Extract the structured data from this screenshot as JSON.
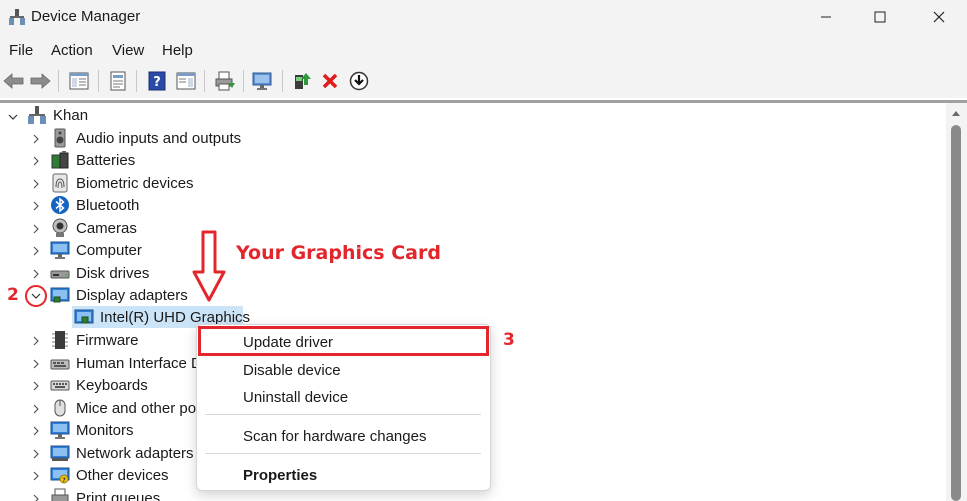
{
  "window": {
    "title": "Device Manager"
  },
  "menu": [
    "File",
    "Action",
    "View",
    "Help"
  ],
  "tree": {
    "root": "Khan",
    "items": [
      {
        "label": "Audio inputs and outputs",
        "icon": "speaker-icon"
      },
      {
        "label": "Batteries",
        "icon": "battery-icon"
      },
      {
        "label": "Biometric devices",
        "icon": "fingerprint-icon"
      },
      {
        "label": "Bluetooth",
        "icon": "bluetooth-icon"
      },
      {
        "label": "Cameras",
        "icon": "camera-icon"
      },
      {
        "label": "Computer",
        "icon": "monitor-icon"
      },
      {
        "label": "Disk drives",
        "icon": "disk-drive-icon"
      },
      {
        "label": "Display adapters",
        "icon": "display-adapter-icon",
        "expanded": true
      },
      {
        "label": "Firmware",
        "icon": "chip-icon"
      },
      {
        "label": "Human Interface D",
        "icon": "hid-icon"
      },
      {
        "label": "Keyboards",
        "icon": "keyboard-icon"
      },
      {
        "label": "Mice and other po",
        "icon": "mouse-icon"
      },
      {
        "label": "Monitors",
        "icon": "monitor-icon"
      },
      {
        "label": "Network adapters",
        "icon": "network-adapter-icon"
      },
      {
        "label": "Other devices",
        "icon": "other-devices-icon"
      },
      {
        "label": "Print queues",
        "icon": "printer-icon"
      }
    ],
    "child_device": "Intel(R) UHD Graphics"
  },
  "context_menu": {
    "update": "Update driver",
    "disable": "Disable device",
    "uninstall": "Uninstall device",
    "scan": "Scan for hardware changes",
    "properties": "Properties"
  },
  "annotations": {
    "step2": "2",
    "step3": "3",
    "callout": "Your Graphics Card",
    "color": "#e3262c"
  }
}
